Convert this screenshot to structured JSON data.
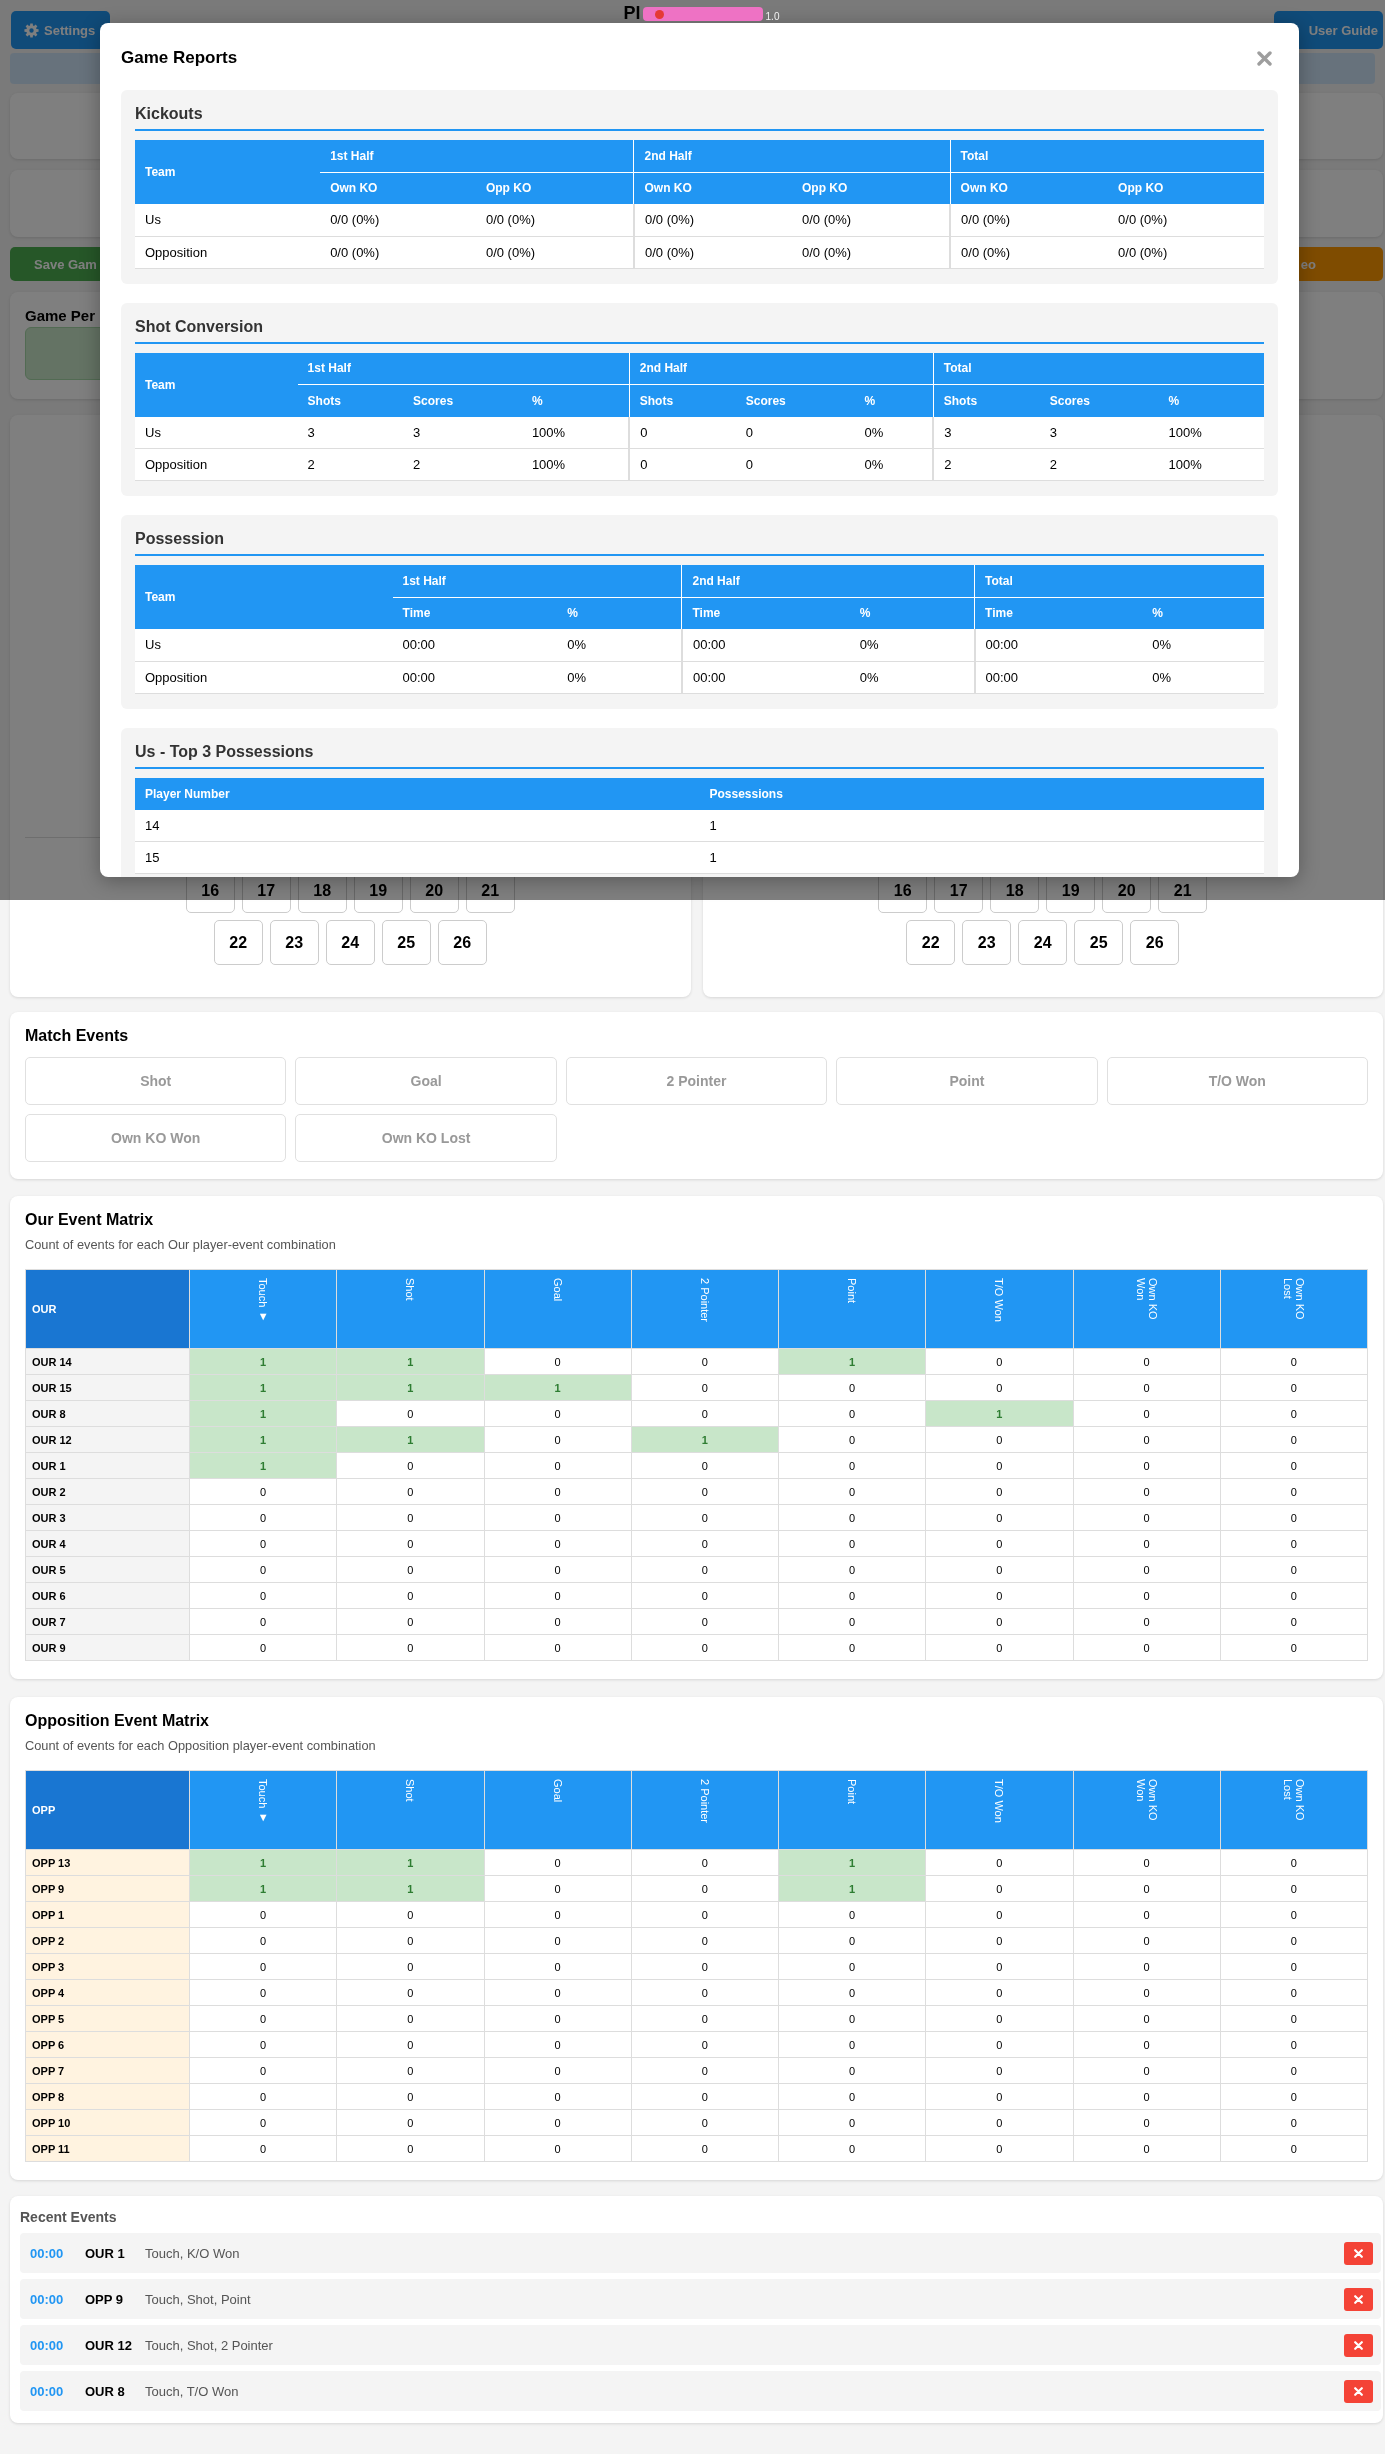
{
  "header": {
    "settings_button": "Settings",
    "title": "Pl",
    "version": "1.0",
    "user_guide_button": "User Guide"
  },
  "modal": {
    "title": "Game Reports",
    "sections": [
      {
        "kind": "split",
        "title": "Kickouts",
        "team_header": "Team",
        "groups": [
          {
            "label": "1st Half",
            "columns": [
              "Own KO",
              "Opp KO"
            ]
          },
          {
            "label": "2nd Half",
            "columns": [
              "Own KO",
              "Opp KO"
            ]
          },
          {
            "label": "Total",
            "columns": [
              "Own KO",
              "Opp KO"
            ]
          }
        ],
        "rows": [
          {
            "team": "Us",
            "cells": [
              "0/0 (0%)",
              "0/0 (0%)",
              "0/0 (0%)",
              "0/0 (0%)",
              "0/0 (0%)",
              "0/0 (0%)"
            ]
          },
          {
            "team": "Opposition",
            "cells": [
              "0/0 (0%)",
              "0/0 (0%)",
              "0/0 (0%)",
              "0/0 (0%)",
              "0/0 (0%)",
              "0/0 (0%)"
            ]
          }
        ]
      },
      {
        "kind": "split",
        "title": "Shot Conversion",
        "team_header": "Team",
        "groups": [
          {
            "label": "1st Half",
            "columns": [
              "Shots",
              "Scores",
              "%"
            ]
          },
          {
            "label": "2nd Half",
            "columns": [
              "Shots",
              "Scores",
              "%"
            ]
          },
          {
            "label": "Total",
            "columns": [
              "Shots",
              "Scores",
              "%"
            ]
          }
        ],
        "rows": [
          {
            "team": "Us",
            "cells": [
              "3",
              "3",
              "100%",
              "0",
              "0",
              "0%",
              "3",
              "3",
              "100%"
            ]
          },
          {
            "team": "Opposition",
            "cells": [
              "2",
              "2",
              "100%",
              "0",
              "0",
              "0%",
              "2",
              "2",
              "100%"
            ]
          }
        ]
      },
      {
        "kind": "split",
        "title": "Possession",
        "team_header": "Team",
        "groups": [
          {
            "label": "1st Half",
            "columns": [
              "Time",
              "%"
            ]
          },
          {
            "label": "2nd Half",
            "columns": [
              "Time",
              "%"
            ]
          },
          {
            "label": "Total",
            "columns": [
              "Time",
              "%"
            ]
          }
        ],
        "rows": [
          {
            "team": "Us",
            "cells": [
              "00:00",
              "0%",
              "00:00",
              "0%",
              "00:00",
              "0%"
            ]
          },
          {
            "team": "Opposition",
            "cells": [
              "00:00",
              "0%",
              "00:00",
              "0%",
              "00:00",
              "0%"
            ]
          }
        ]
      },
      {
        "kind": "simple",
        "title": "Us - Top 3 Possessions",
        "columns": [
          "Player Number",
          "Possessions"
        ],
        "rows": [
          [
            "14",
            "1"
          ],
          [
            "15",
            "1"
          ]
        ]
      }
    ]
  },
  "toolbar": {
    "save_button": "Save Gam",
    "right_button": "eo"
  },
  "game_panel": {
    "title": "Game Per"
  },
  "squad_panels": [
    {
      "number_rows": [
        [
          "16",
          "17",
          "18",
          "19",
          "20",
          "21"
        ],
        [
          "22",
          "23",
          "24",
          "25",
          "26"
        ]
      ]
    },
    {
      "number_rows": [
        [
          "16",
          "17",
          "18",
          "19",
          "20",
          "21"
        ],
        [
          "22",
          "23",
          "24",
          "25",
          "26"
        ]
      ]
    }
  ],
  "match_events": {
    "title": "Match Events",
    "buttons": [
      {
        "label": "Shot",
        "disabled": true
      },
      {
        "label": "Goal",
        "disabled": true
      },
      {
        "label": "2 Pointer",
        "disabled": true
      },
      {
        "label": "Point",
        "disabled": true
      },
      {
        "label": "T/O Won",
        "disabled": true
      },
      {
        "label": "Own KO Won",
        "disabled": true
      },
      {
        "label": "Own KO Lost",
        "disabled": true
      }
    ]
  },
  "our_event_matrix": {
    "title": "Our Event Matrix",
    "subtitle": "Count of events for each Our player-event combination",
    "corner": "OUR",
    "columns": [
      "Touch ▼",
      "Shot",
      "Goal",
      "2 Pointer",
      "Point",
      "T/O Won",
      "Own KO Won",
      "Own KO Lost"
    ],
    "rows": [
      {
        "label": "OUR 14",
        "cells": [
          {
            "value": "1",
            "highlighted": true
          },
          {
            "value": "1",
            "highlighted": true
          },
          {
            "value": "0",
            "highlighted": false
          },
          {
            "value": "0",
            "highlighted": false
          },
          {
            "value": "1",
            "highlighted": true
          },
          {
            "value": "0",
            "highlighted": false
          },
          {
            "value": "0",
            "highlighted": false
          },
          {
            "value": "0",
            "highlighted": false
          }
        ]
      },
      {
        "label": "OUR 15",
        "cells": [
          {
            "value": "1",
            "highlighted": true
          },
          {
            "value": "1",
            "highlighted": true
          },
          {
            "value": "1",
            "highlighted": true
          },
          {
            "value": "0",
            "highlighted": false
          },
          {
            "value": "0",
            "highlighted": false
          },
          {
            "value": "0",
            "highlighted": false
          },
          {
            "value": "0",
            "highlighted": false
          },
          {
            "value": "0",
            "highlighted": false
          }
        ]
      },
      {
        "label": "OUR 8",
        "cells": [
          {
            "value": "1",
            "highlighted": true
          },
          {
            "value": "0",
            "highlighted": false
          },
          {
            "value": "0",
            "highlighted": false
          },
          {
            "value": "0",
            "highlighted": false
          },
          {
            "value": "0",
            "highlighted": false
          },
          {
            "value": "1",
            "highlighted": true
          },
          {
            "value": "0",
            "highlighted": false
          },
          {
            "value": "0",
            "highlighted": false
          }
        ]
      },
      {
        "label": "OUR 12",
        "cells": [
          {
            "value": "1",
            "highlighted": true
          },
          {
            "value": "1",
            "highlighted": true
          },
          {
            "value": "0",
            "highlighted": false
          },
          {
            "value": "1",
            "highlighted": true
          },
          {
            "value": "0",
            "highlighted": false
          },
          {
            "value": "0",
            "highlighted": false
          },
          {
            "value": "0",
            "highlighted": false
          },
          {
            "value": "0",
            "highlighted": false
          }
        ]
      },
      {
        "label": "OUR 1",
        "cells": [
          {
            "value": "1",
            "highlighted": true
          },
          {
            "value": "0",
            "highlighted": false
          },
          {
            "value": "0",
            "highlighted": false
          },
          {
            "value": "0",
            "highlighted": false
          },
          {
            "value": "0",
            "highlighted": false
          },
          {
            "value": "0",
            "highlighted": false
          },
          {
            "value": "0",
            "highlighted": false
          },
          {
            "value": "0",
            "highlighted": false
          }
        ]
      },
      {
        "label": "OUR 2",
        "cells": [
          {
            "value": "0",
            "highlighted": false
          },
          {
            "value": "0",
            "highlighted": false
          },
          {
            "value": "0",
            "highlighted": false
          },
          {
            "value": "0",
            "highlighted": false
          },
          {
            "value": "0",
            "highlighted": false
          },
          {
            "value": "0",
            "highlighted": false
          },
          {
            "value": "0",
            "highlighted": false
          },
          {
            "value": "0",
            "highlighted": false
          }
        ]
      },
      {
        "label": "OUR 3",
        "cells": [
          {
            "value": "0",
            "highlighted": false
          },
          {
            "value": "0",
            "highlighted": false
          },
          {
            "value": "0",
            "highlighted": false
          },
          {
            "value": "0",
            "highlighted": false
          },
          {
            "value": "0",
            "highlighted": false
          },
          {
            "value": "0",
            "highlighted": false
          },
          {
            "value": "0",
            "highlighted": false
          },
          {
            "value": "0",
            "highlighted": false
          }
        ]
      },
      {
        "label": "OUR 4",
        "cells": [
          {
            "value": "0",
            "highlighted": false
          },
          {
            "value": "0",
            "highlighted": false
          },
          {
            "value": "0",
            "highlighted": false
          },
          {
            "value": "0",
            "highlighted": false
          },
          {
            "value": "0",
            "highlighted": false
          },
          {
            "value": "0",
            "highlighted": false
          },
          {
            "value": "0",
            "highlighted": false
          },
          {
            "value": "0",
            "highlighted": false
          }
        ]
      },
      {
        "label": "OUR 5",
        "cells": [
          {
            "value": "0",
            "highlighted": false
          },
          {
            "value": "0",
            "highlighted": false
          },
          {
            "value": "0",
            "highlighted": false
          },
          {
            "value": "0",
            "highlighted": false
          },
          {
            "value": "0",
            "highlighted": false
          },
          {
            "value": "0",
            "highlighted": false
          },
          {
            "value": "0",
            "highlighted": false
          },
          {
            "value": "0",
            "highlighted": false
          }
        ]
      },
      {
        "label": "OUR 6",
        "cells": [
          {
            "value": "0",
            "highlighted": false
          },
          {
            "value": "0",
            "highlighted": false
          },
          {
            "value": "0",
            "highlighted": false
          },
          {
            "value": "0",
            "highlighted": false
          },
          {
            "value": "0",
            "highlighted": false
          },
          {
            "value": "0",
            "highlighted": false
          },
          {
            "value": "0",
            "highlighted": false
          },
          {
            "value": "0",
            "highlighted": false
          }
        ]
      },
      {
        "label": "OUR 7",
        "cells": [
          {
            "value": "0",
            "highlighted": false
          },
          {
            "value": "0",
            "highlighted": false
          },
          {
            "value": "0",
            "highlighted": false
          },
          {
            "value": "0",
            "highlighted": false
          },
          {
            "value": "0",
            "highlighted": false
          },
          {
            "value": "0",
            "highlighted": false
          },
          {
            "value": "0",
            "highlighted": false
          },
          {
            "value": "0",
            "highlighted": false
          }
        ]
      },
      {
        "label": "OUR 9",
        "cells": [
          {
            "value": "0",
            "highlighted": false
          },
          {
            "value": "0",
            "highlighted": false
          },
          {
            "value": "0",
            "highlighted": false
          },
          {
            "value": "0",
            "highlighted": false
          },
          {
            "value": "0",
            "highlighted": false
          },
          {
            "value": "0",
            "highlighted": false
          },
          {
            "value": "0",
            "highlighted": false
          },
          {
            "value": "0",
            "highlighted": false
          }
        ]
      }
    ]
  },
  "opposition_event_matrix": {
    "title": "Opposition Event Matrix",
    "subtitle": "Count of events for each Opposition player-event combination",
    "corner": "OPP",
    "columns": [
      "Touch ▼",
      "Shot",
      "Goal",
      "2 Pointer",
      "Point",
      "T/O Won",
      "Own KO Won",
      "Own KO Lost"
    ],
    "rows": [
      {
        "label": "OPP 13",
        "cells": [
          {
            "value": "1",
            "highlighted": true
          },
          {
            "value": "1",
            "highlighted": true
          },
          {
            "value": "0",
            "highlighted": false
          },
          {
            "value": "0",
            "highlighted": false
          },
          {
            "value": "1",
            "highlighted": true
          },
          {
            "value": "0",
            "highlighted": false
          },
          {
            "value": "0",
            "highlighted": false
          },
          {
            "value": "0",
            "highlighted": false
          }
        ]
      },
      {
        "label": "OPP 9",
        "cells": [
          {
            "value": "1",
            "highlighted": true
          },
          {
            "value": "1",
            "highlighted": true
          },
          {
            "value": "0",
            "highlighted": false
          },
          {
            "value": "0",
            "highlighted": false
          },
          {
            "value": "1",
            "highlighted": true
          },
          {
            "value": "0",
            "highlighted": false
          },
          {
            "value": "0",
            "highlighted": false
          },
          {
            "value": "0",
            "highlighted": false
          }
        ]
      },
      {
        "label": "OPP 1",
        "cells": [
          {
            "value": "0",
            "highlighted": false
          },
          {
            "value": "0",
            "highlighted": false
          },
          {
            "value": "0",
            "highlighted": false
          },
          {
            "value": "0",
            "highlighted": false
          },
          {
            "value": "0",
            "highlighted": false
          },
          {
            "value": "0",
            "highlighted": false
          },
          {
            "value": "0",
            "highlighted": false
          },
          {
            "value": "0",
            "highlighted": false
          }
        ]
      },
      {
        "label": "OPP 2",
        "cells": [
          {
            "value": "0",
            "highlighted": false
          },
          {
            "value": "0",
            "highlighted": false
          },
          {
            "value": "0",
            "highlighted": false
          },
          {
            "value": "0",
            "highlighted": false
          },
          {
            "value": "0",
            "highlighted": false
          },
          {
            "value": "0",
            "highlighted": false
          },
          {
            "value": "0",
            "highlighted": false
          },
          {
            "value": "0",
            "highlighted": false
          }
        ]
      },
      {
        "label": "OPP 3",
        "cells": [
          {
            "value": "0",
            "highlighted": false
          },
          {
            "value": "0",
            "highlighted": false
          },
          {
            "value": "0",
            "highlighted": false
          },
          {
            "value": "0",
            "highlighted": false
          },
          {
            "value": "0",
            "highlighted": false
          },
          {
            "value": "0",
            "highlighted": false
          },
          {
            "value": "0",
            "highlighted": false
          },
          {
            "value": "0",
            "highlighted": false
          }
        ]
      },
      {
        "label": "OPP 4",
        "cells": [
          {
            "value": "0",
            "highlighted": false
          },
          {
            "value": "0",
            "highlighted": false
          },
          {
            "value": "0",
            "highlighted": false
          },
          {
            "value": "0",
            "highlighted": false
          },
          {
            "value": "0",
            "highlighted": false
          },
          {
            "value": "0",
            "highlighted": false
          },
          {
            "value": "0",
            "highlighted": false
          },
          {
            "value": "0",
            "highlighted": false
          }
        ]
      },
      {
        "label": "OPP 5",
        "cells": [
          {
            "value": "0",
            "highlighted": false
          },
          {
            "value": "0",
            "highlighted": false
          },
          {
            "value": "0",
            "highlighted": false
          },
          {
            "value": "0",
            "highlighted": false
          },
          {
            "value": "0",
            "highlighted": false
          },
          {
            "value": "0",
            "highlighted": false
          },
          {
            "value": "0",
            "highlighted": false
          },
          {
            "value": "0",
            "highlighted": false
          }
        ]
      },
      {
        "label": "OPP 6",
        "cells": [
          {
            "value": "0",
            "highlighted": false
          },
          {
            "value": "0",
            "highlighted": false
          },
          {
            "value": "0",
            "highlighted": false
          },
          {
            "value": "0",
            "highlighted": false
          },
          {
            "value": "0",
            "highlighted": false
          },
          {
            "value": "0",
            "highlighted": false
          },
          {
            "value": "0",
            "highlighted": false
          },
          {
            "value": "0",
            "highlighted": false
          }
        ]
      },
      {
        "label": "OPP 7",
        "cells": [
          {
            "value": "0",
            "highlighted": false
          },
          {
            "value": "0",
            "highlighted": false
          },
          {
            "value": "0",
            "highlighted": false
          },
          {
            "value": "0",
            "highlighted": false
          },
          {
            "value": "0",
            "highlighted": false
          },
          {
            "value": "0",
            "highlighted": false
          },
          {
            "value": "0",
            "highlighted": false
          },
          {
            "value": "0",
            "highlighted": false
          }
        ]
      },
      {
        "label": "OPP 8",
        "cells": [
          {
            "value": "0",
            "highlighted": false
          },
          {
            "value": "0",
            "highlighted": false
          },
          {
            "value": "0",
            "highlighted": false
          },
          {
            "value": "0",
            "highlighted": false
          },
          {
            "value": "0",
            "highlighted": false
          },
          {
            "value": "0",
            "highlighted": false
          },
          {
            "value": "0",
            "highlighted": false
          },
          {
            "value": "0",
            "highlighted": false
          }
        ]
      },
      {
        "label": "OPP 10",
        "cells": [
          {
            "value": "0",
            "highlighted": false
          },
          {
            "value": "0",
            "highlighted": false
          },
          {
            "value": "0",
            "highlighted": false
          },
          {
            "value": "0",
            "highlighted": false
          },
          {
            "value": "0",
            "highlighted": false
          },
          {
            "value": "0",
            "highlighted": false
          },
          {
            "value": "0",
            "highlighted": false
          },
          {
            "value": "0",
            "highlighted": false
          }
        ]
      },
      {
        "label": "OPP 11",
        "cells": [
          {
            "value": "0",
            "highlighted": false
          },
          {
            "value": "0",
            "highlighted": false
          },
          {
            "value": "0",
            "highlighted": false
          },
          {
            "value": "0",
            "highlighted": false
          },
          {
            "value": "0",
            "highlighted": false
          },
          {
            "value": "0",
            "highlighted": false
          },
          {
            "value": "0",
            "highlighted": false
          },
          {
            "value": "0",
            "highlighted": false
          }
        ]
      }
    ]
  },
  "recent_events": {
    "title": "Recent Events",
    "items": [
      {
        "time": "00:00",
        "player": "OUR 1",
        "events": "Touch, K/O Won"
      },
      {
        "time": "00:00",
        "player": "OPP 9",
        "events": "Touch, Shot, Point"
      },
      {
        "time": "00:00",
        "player": "OUR 12",
        "events": "Touch, Shot, 2 Pointer"
      },
      {
        "time": "00:00",
        "player": "OUR 8",
        "events": "Touch, T/O Won"
      }
    ]
  }
}
